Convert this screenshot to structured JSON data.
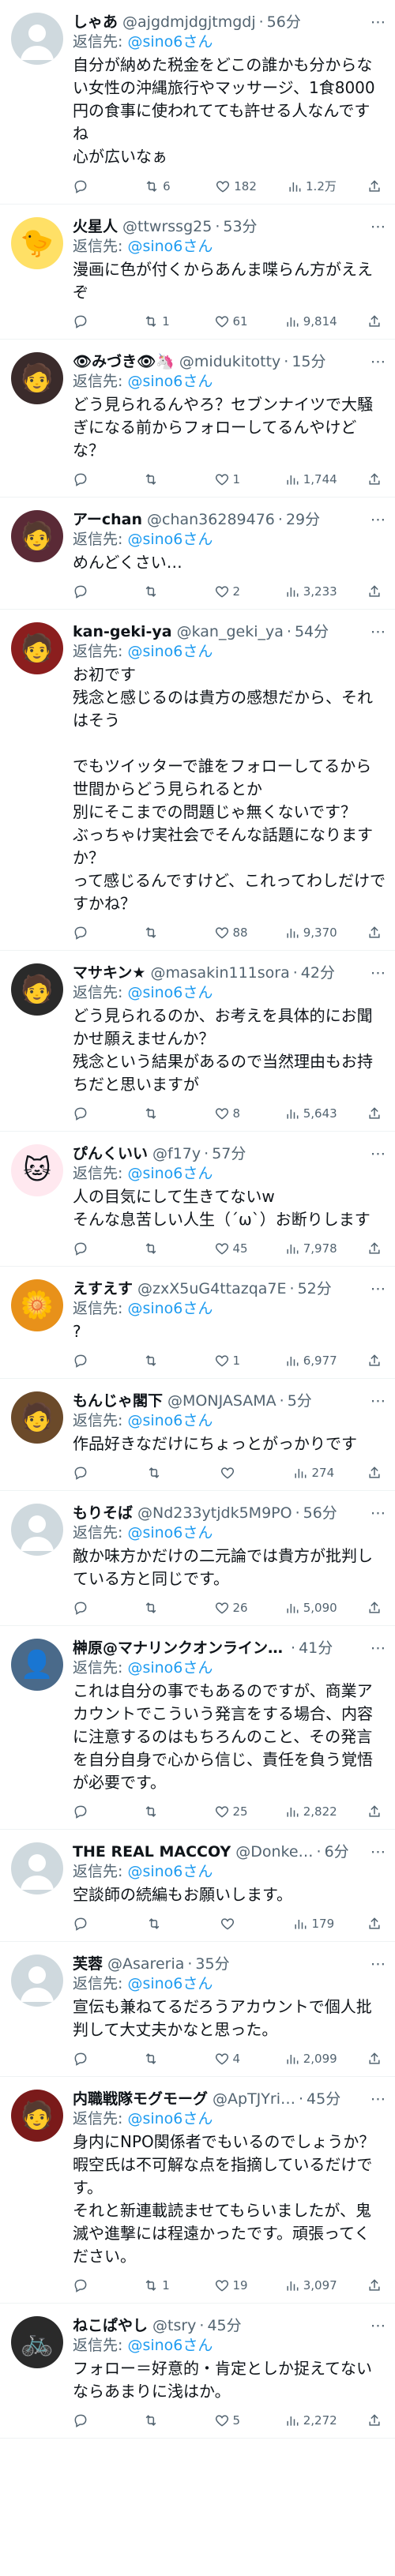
{
  "reply_prefix": "返信先:",
  "tweets": [
    {
      "name": "しゃあ",
      "handle": "@ajgdmjdgjtmgdj",
      "time": "56分",
      "reply_to": "@sino6さん",
      "text": "自分が納めた税金をどこの誰かも分からない女性の沖縄旅行やマッサージ、1食8000円の食事に使われてても許せる人なんですね\n心が広いなぁ",
      "replies": "",
      "retweets": "6",
      "likes": "182",
      "views": "1.2万",
      "avatar_color": "#cfd9de",
      "avatar_icon": "default-user-icon"
    },
    {
      "name": "火星人",
      "handle": "@ttwrssg25",
      "time": "53分",
      "reply_to": "@sino6さん",
      "text": "漫画に色が付くからあんま喋らん方がええぞ",
      "replies": "",
      "retweets": "1",
      "likes": "61",
      "views": "9,814",
      "avatar_color": "#ffe066",
      "avatar_icon": "duck-icon"
    },
    {
      "name": "👁みづき👁🦄",
      "handle": "@midukitotty",
      "time": "15分",
      "reply_to": "@sino6さん",
      "text": "どう見られるんやろ？セブンナイツで大騒ぎになる前からフォローしてるんやけどな？",
      "replies": "",
      "retweets": "",
      "likes": "1",
      "views": "1,744",
      "avatar_color": "#3a2b2b",
      "avatar_icon": "anime-avatar-icon"
    },
    {
      "name": "アーchan",
      "handle": "@chan36289476",
      "time": "29分",
      "reply_to": "@sino6さん",
      "text": "めんどくさい…",
      "replies": "",
      "retweets": "",
      "likes": "2",
      "views": "3,233",
      "avatar_color": "#5a2a36",
      "avatar_icon": "anime-avatar-icon"
    },
    {
      "name": "kan-geki-ya",
      "handle": "@kan_geki_ya",
      "time": "54分",
      "reply_to": "@sino6さん",
      "text": "お初です\n残念と感じるのは貴方の感想だから、それはそう\n\nでもツイッターで誰をフォローしてるから世間からどう見られるとか\n別にそこまでの問題じゃ無くないです？\nぶっちゃけ実社会でそんな話題になりますか？\nって感じるんですけど、これってわしだけですかね？",
      "replies": "",
      "retweets": "",
      "likes": "88",
      "views": "9,370",
      "avatar_color": "#8b1e1e",
      "avatar_icon": "character-icon"
    },
    {
      "name": "マサキン★",
      "handle": "@masakin111sora",
      "time": "42分",
      "reply_to": "@sino6さん",
      "text": "どう見られるのか、お考えを具体的にお聞かせ願えませんか？\n残念という結果があるので当然理由もお持ちだと思いますが",
      "replies": "",
      "retweets": "",
      "likes": "8",
      "views": "5,643",
      "avatar_color": "#2a2a2a",
      "avatar_icon": "character-icon"
    },
    {
      "name": "ぴんくいい",
      "handle": "@f17y",
      "time": "57分",
      "reply_to": "@sino6さん",
      "text": "人の目気にして生きてないw\nそんな息苦しい人生（´ω`）お断りします",
      "replies": "",
      "retweets": "",
      "likes": "45",
      "views": "7,978",
      "avatar_color": "#ffe8ef",
      "avatar_icon": "cat-icon"
    },
    {
      "name": "えすえす",
      "handle": "@zxX5uG4ttazqa7E",
      "time": "52分",
      "reply_to": "@sino6さん",
      "text": "?",
      "replies": "",
      "retweets": "",
      "likes": "1",
      "views": "6,977",
      "avatar_color": "#e8911a",
      "avatar_icon": "flower-icon"
    },
    {
      "name": "もんじゃ閣下",
      "handle": "@MONJASAMA",
      "time": "5分",
      "reply_to": "@sino6さん",
      "text": "作品好きなだけにちょっとがっかりです",
      "replies": "",
      "retweets": "",
      "likes": "",
      "views": "274",
      "avatar_color": "#6b4a2a",
      "avatar_icon": "character-icon"
    },
    {
      "name": "もりそば",
      "handle": "@Nd233ytjdk5M9PO",
      "time": "56分",
      "reply_to": "@sino6さん",
      "text": "敵か味方かだけの二元論では貴方が批判している方と同じです。",
      "replies": "",
      "retweets": "",
      "likes": "26",
      "views": "5,090",
      "avatar_color": "#cfd9de",
      "avatar_icon": "default-user-icon"
    },
    {
      "name": "榊原@マナリンクオンライン…",
      "handle": "",
      "time": "41分",
      "reply_to": "@sino6さん",
      "text": "これは自分の事でもあるのですが、商業アカウントでこういう発言をする場合、内容に注意するのはもちろんのこと、その発言を自分自身で心から信じ、責任を負う覚悟が必要です。",
      "replies": "",
      "retweets": "",
      "likes": "25",
      "views": "2,822",
      "avatar_color": "#4a6a8a",
      "avatar_icon": "photo-icon"
    },
    {
      "name": "THE REAL MACCOY",
      "handle": "@Donke…",
      "time": "6分",
      "reply_to": "@sino6さん",
      "text": "空談師の続編もお願いします。",
      "replies": "",
      "retweets": "",
      "likes": "",
      "views": "179",
      "avatar_color": "#cfd9de",
      "avatar_icon": "default-user-icon"
    },
    {
      "name": "芙蓉",
      "handle": "@Asareria",
      "time": "35分",
      "reply_to": "@sino6さん",
      "text": "宣伝も兼ねてるだろうアカウントで個人批判して大丈夫かなと思った。",
      "replies": "",
      "retweets": "",
      "likes": "4",
      "views": "2,099",
      "avatar_color": "#cfd9de",
      "avatar_icon": "default-user-icon"
    },
    {
      "name": "内職戦隊モグモーグ",
      "handle": "@ApTJYri…",
      "time": "45分",
      "reply_to": "@sino6さん",
      "text": "身内にNPO関係者でもいるのでしょうか？\n暇空氏は不可解な点を指摘しているだけです。\nそれと新連載読ませてもらいましたが、鬼滅や進撃には程遠かったです。頑張ってください。",
      "replies": "",
      "retweets": "1",
      "likes": "19",
      "views": "3,097",
      "avatar_color": "#7a1a1a",
      "avatar_icon": "character-icon"
    },
    {
      "name": "ねこぱやし",
      "handle": "@tsry",
      "time": "45分",
      "reply_to": "@sino6さん",
      "text": "フォロー＝好意的・肯定としか捉えてないならあまりに浅はか。",
      "replies": "",
      "retweets": "",
      "likes": "5",
      "views": "2,272",
      "avatar_color": "#2a2a2a",
      "avatar_icon": "bicycle-icon"
    }
  ]
}
